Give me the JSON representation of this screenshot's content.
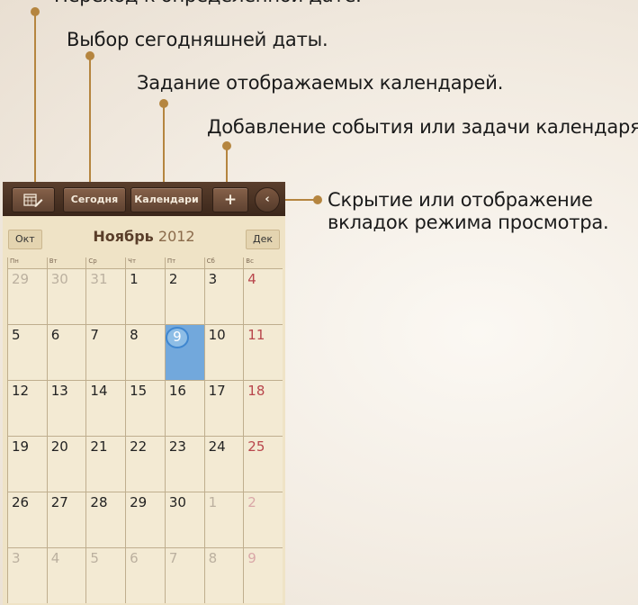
{
  "annotations": {
    "top_partial": "Переход к определенной дате.",
    "today": "Выбор сегодняшней даты.",
    "calendars": "Задание отображаемых календарей.",
    "add": "Добавление события или задачи календаря.",
    "toggle_line1": "Скрытие или отображение",
    "toggle_line2": "вкладок режима просмотра."
  },
  "toolbar": {
    "goto_icon": "calendar-pen-icon",
    "today_label": "Сегодня",
    "calendars_label": "Календари",
    "add_label": "+",
    "toggle_label": "‹"
  },
  "month_nav": {
    "prev": "Окт",
    "month": "Ноябрь",
    "year": "2012",
    "next": "Дек"
  },
  "weekdays": [
    "Пн",
    "Вт",
    "Ср",
    "Чт",
    "Пт",
    "Сб",
    "Вс"
  ],
  "weeks": [
    [
      "29",
      "30",
      "31",
      "1",
      "2",
      "3",
      "4"
    ],
    [
      "5",
      "6",
      "7",
      "8",
      "9",
      "10",
      "11"
    ],
    [
      "12",
      "13",
      "14",
      "15",
      "16",
      "17",
      "18"
    ],
    [
      "19",
      "20",
      "21",
      "22",
      "23",
      "24",
      "25"
    ],
    [
      "26",
      "27",
      "28",
      "29",
      "30",
      "1",
      "2"
    ],
    [
      "3",
      "4",
      "5",
      "6",
      "7",
      "8",
      "9"
    ]
  ],
  "other_month": [
    [
      true,
      true,
      true,
      false,
      false,
      false,
      false
    ],
    [
      false,
      false,
      false,
      false,
      false,
      false,
      false
    ],
    [
      false,
      false,
      false,
      false,
      false,
      false,
      false
    ],
    [
      false,
      false,
      false,
      false,
      false,
      false,
      false
    ],
    [
      false,
      false,
      false,
      false,
      false,
      true,
      true
    ],
    [
      true,
      true,
      true,
      true,
      true,
      true,
      true
    ]
  ],
  "today": {
    "week": 1,
    "day": 4
  },
  "colors": {
    "accent": "#b5853f",
    "today": "#72a8dc",
    "sunday": "#b8464c",
    "toolbar": "#4a3223"
  }
}
